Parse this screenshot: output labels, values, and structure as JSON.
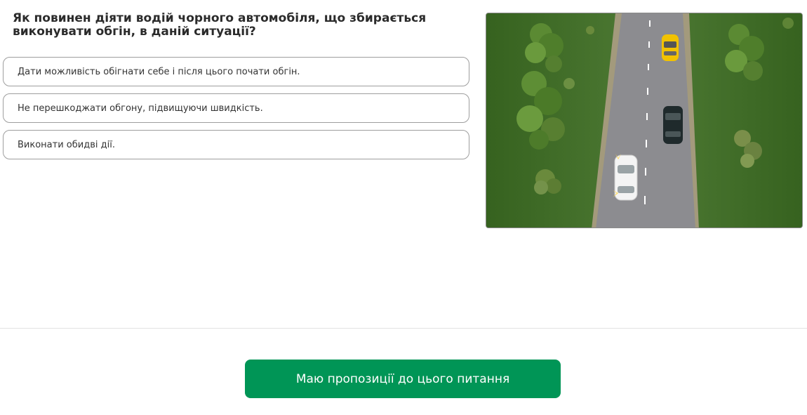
{
  "question": {
    "text": "Як повинен діяти водій чорного автомобіля, що збирається виконувати обгін, в даній ситуації?"
  },
  "answers": [
    {
      "label": "Дати можливість обігнати себе і після цього почати обгін."
    },
    {
      "label": "Не перешкоджати обгону, підвищуючи швидкість."
    },
    {
      "label": "Виконати обидві дії."
    }
  ],
  "scene": {
    "icon": "road-scene-illustration",
    "vehicles": [
      "yellow-car-icon",
      "black-car-icon",
      "white-car-icon"
    ],
    "colors": {
      "grass": "#3f6a28",
      "road": "#8c8c90",
      "yellow_car": "#f2c200",
      "black_car": "#1f2a2c",
      "white_car": "#f4f4f4"
    }
  },
  "footer": {
    "propose_label": "Маю пропозиції до цього питання",
    "accent": "#009556"
  }
}
